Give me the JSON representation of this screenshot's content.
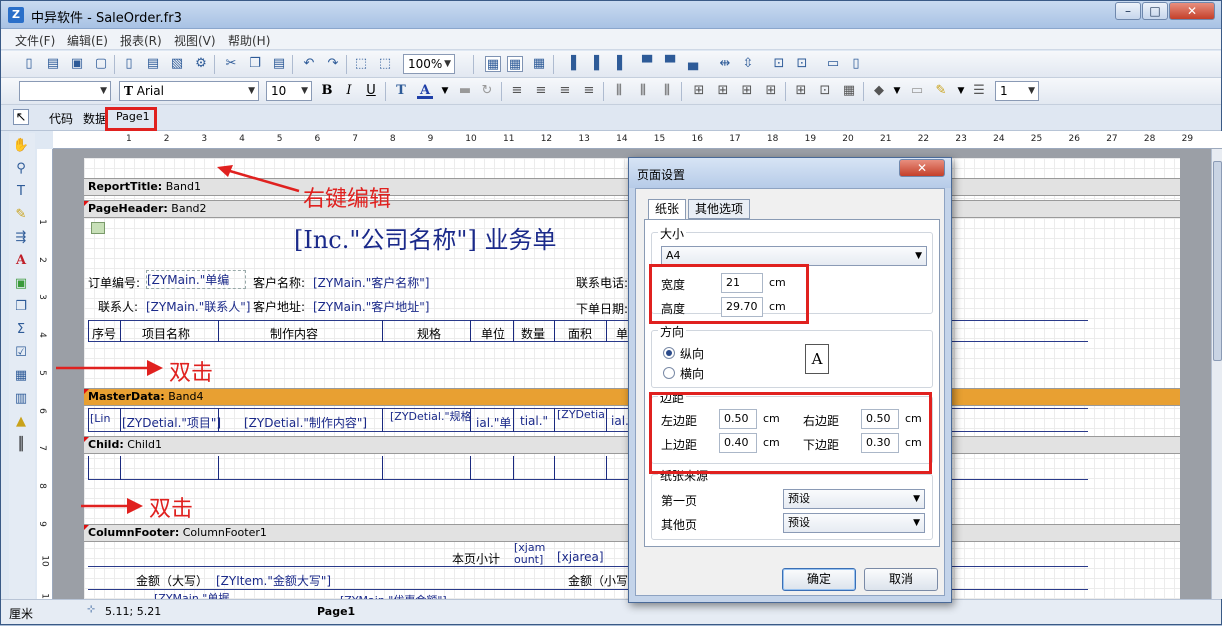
{
  "window": {
    "title": "中异软件 - SaleOrder.fr3",
    "app_icon": "Z",
    "controls": [
      "–",
      "□",
      "✕"
    ]
  },
  "menu": [
    "文件(F)",
    "编辑(E)",
    "报表(R)",
    "视图(V)",
    "帮助(H)"
  ],
  "toolbar": {
    "zoom": "100%",
    "font_name": "Arial",
    "font_size": "10",
    "line_width": "1"
  },
  "tabs": {
    "code": "代码",
    "data": "数据",
    "page": "Page1"
  },
  "ruler": {
    "h": [
      "1",
      "2",
      "3",
      "4",
      "5",
      "6",
      "7",
      "8",
      "9",
      "10",
      "11",
      "12",
      "13",
      "14",
      "15",
      "16",
      "17",
      "18",
      "19",
      "20",
      "21",
      "22",
      "23",
      "24",
      "25",
      "26",
      "27",
      "28",
      "29"
    ],
    "v": [
      "1",
      "2",
      "3",
      "4",
      "5",
      "6",
      "7",
      "8",
      "9",
      "10",
      "11"
    ]
  },
  "report": {
    "report_title_band": {
      "name": "ReportTitle:",
      "label": "Band1"
    },
    "page_header_band": {
      "name": "PageHeader:",
      "label": "Band2"
    },
    "title_text": "[Inc.\"公司名称\"] 业务单",
    "order_no_label": "订单编号:",
    "order_no_field": "[ZYMain.\"单编",
    "customer_label": "客户名称:",
    "customer_field": "[ZYMain.\"客户名称\"]",
    "phone_label": "联系电话:",
    "contact_label": "联系人:",
    "contact_field": "[ZYMain.\"联系人\"]",
    "address_label": "客户地址:",
    "address_field": "[ZYMain.\"客户地址\"]",
    "order_date_label": "下单日期:",
    "columns": [
      "序号",
      "项目名称",
      "制作内容",
      "规格",
      "单位",
      "数量",
      "面积",
      "单"
    ],
    "master_band": {
      "name": "MasterData:",
      "label": "Band4"
    },
    "detail_fields": [
      "[Lin",
      "[ZYDetial.\"项目\"]",
      "[ZYDetial.\"制作内容\"]",
      "[ZYDetial.\"规格",
      "ial.\"单",
      "tial.\"",
      "[ZYDetial",
      "ial."
    ],
    "child_band": {
      "name": "Child:",
      "label": "Child1"
    },
    "column_footer_band": {
      "name": "ColumnFooter:",
      "label": "ColumnFooter1"
    },
    "page_subtotal_label": "本页小计",
    "subtotal_field_1": "[xjam ount]",
    "subtotal_field_2": "[xjarea]",
    "amount_upper_label": "金额（大写）",
    "amount_upper_field": "[ZYItem.\"金额大写\"]",
    "amount_lower_label": "金额（小写",
    "bottom_cut_field_1": "[ZYMain.\"单据",
    "bottom_cut_field_2": "[ZYMain.\"优惠金额\"]"
  },
  "annotations": {
    "right_click_edit": "右键编辑",
    "double_click_1": "双击",
    "double_click_2": "双击"
  },
  "dialog": {
    "title": "页面设置",
    "close": "✕",
    "tabs": [
      "纸张",
      "其他选项"
    ],
    "size_group": "大小",
    "size_value": "A4",
    "width_label": "宽度",
    "width_value": "21",
    "height_label": "高度",
    "height_value": "29.70",
    "unit": "cm",
    "orientation_group": "方向",
    "portrait": "纵向",
    "landscape": "横向",
    "orientation_icon": "A",
    "margins_group": "边距",
    "left_label": "左边距",
    "left_value": "0.50",
    "right_label": "右边距",
    "right_value": "0.50",
    "top_label": "上边距",
    "top_value": "0.40",
    "bottom_label": "下边距",
    "bottom_value": "0.30",
    "source_group": "纸张来源",
    "first_page_label": "第一页",
    "first_page_value": "预设",
    "other_pages_label": "其他页",
    "other_pages_value": "预设",
    "ok": "确定",
    "cancel": "取消"
  },
  "status": {
    "unit": "厘米",
    "coords": "5.11; 5.21",
    "page": "Page1"
  },
  "colors": {
    "annotation_red": "#e0211f",
    "master_band": "#e8a032",
    "field_blue": "#1b2a8a"
  }
}
